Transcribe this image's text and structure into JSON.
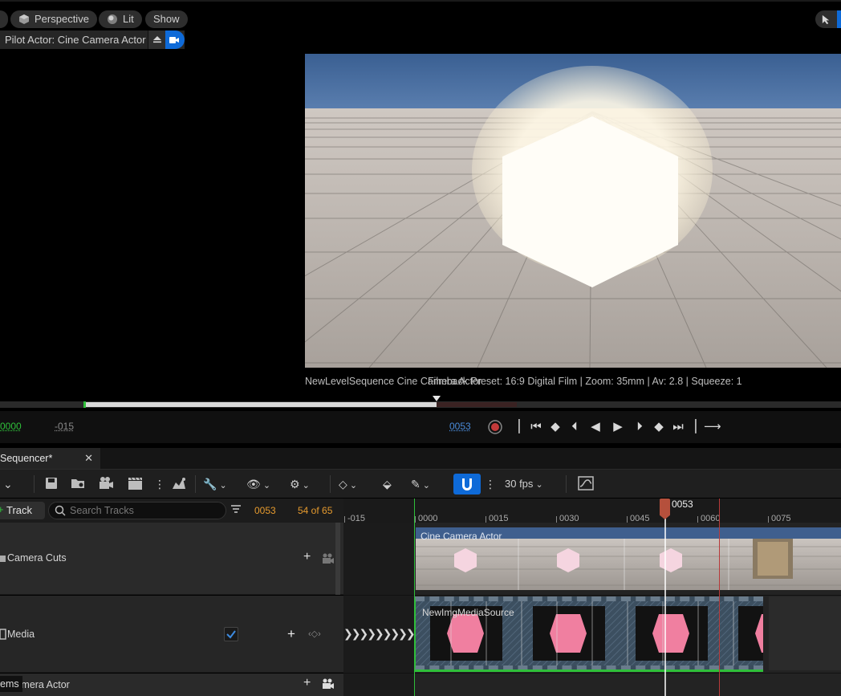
{
  "viewport": {
    "perspective_label": "Perspective",
    "lit_label": "Lit",
    "show_label": "Show",
    "pilot_label": "Pilot Actor: Cine Camera Actor",
    "camera_info": "NewLevelSequence  Cine Camera Actor",
    "filmback_info": "Filmback Preset: 16:9 Digital Film | Zoom: 35mm | Av: 2.8 | Squeeze: 1"
  },
  "transport": {
    "start_time": "0000",
    "offset_time": "-015",
    "current_time": "0053"
  },
  "sequencer": {
    "tab_title": "Sequencer*",
    "fps_label": "30 fps",
    "add_track_label": "Track",
    "search_placeholder": "Search Tracks",
    "current_frame": "0053",
    "frame_count": "54 of 65",
    "playhead_label": "0053",
    "ruler_ticks": [
      "-015",
      "0000",
      "0015",
      "0030",
      "0045",
      "0060",
      "0075"
    ],
    "tracks": [
      {
        "label": "Camera Cuts",
        "section_label": "Cine Camera Actor"
      },
      {
        "label": "Media",
        "section_label": "NewImgMediaSource"
      },
      {
        "label": "e Camera Actor"
      }
    ],
    "items_label": "ems"
  },
  "colors": {
    "accent": "#0e6ad8",
    "start_marker": "#2fbf3a",
    "end_marker": "#b83a3a",
    "playhead": "#b5503c",
    "media_pink": "#f07fa0",
    "current_time": "#4a8ad8",
    "start_time": "#2fbf3a",
    "frame_count": "#e59a2e"
  }
}
